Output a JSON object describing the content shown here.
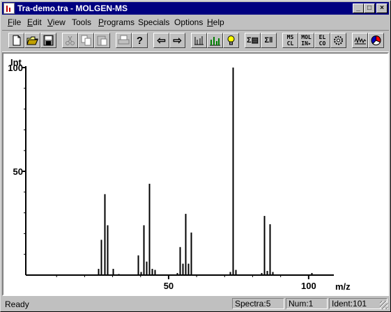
{
  "window": {
    "title": "Tra-demo.tra - MOLGEN-MS",
    "controls": {
      "minimize": "_",
      "maximize": "□",
      "close": "×"
    }
  },
  "menu": [
    {
      "label": "File",
      "key": "F",
      "rest": "ile"
    },
    {
      "label": "Edit",
      "key": "E",
      "rest": "dit"
    },
    {
      "label": "View",
      "key": "V",
      "rest": "iew"
    },
    {
      "label": "Tools",
      "key": "",
      "rest": "Tools"
    },
    {
      "label": "Programs",
      "key": "P",
      "rest": "rograms"
    },
    {
      "label": "Specials",
      "key": "",
      "rest": "Specials"
    },
    {
      "label": "Options",
      "key": "",
      "rest": "Options"
    },
    {
      "label": "Help",
      "key": "H",
      "rest": "elp"
    }
  ],
  "toolbar": {
    "new_icon": "new-document-icon",
    "open_icon": "open-folder-icon",
    "save_icon": "save-disk-icon",
    "cut_icon": "scissors-icon",
    "copy_icon": "copy-icon",
    "paste_icon": "paste-icon",
    "print_icon": "printer-icon",
    "help_glyph": "?",
    "back_glyph": "⇦",
    "forward_glyph": "⇨",
    "spectrum_list_glyph": "!! !!",
    "bar_chart_icon": "bar-chart-icon",
    "idea_icon": "light-bulb-icon",
    "sum_list_glyph": "Σ▤",
    "sum_glyph": "Σ‖",
    "ms_cl_glyph": "MS CL",
    "mol_in_glyph": "MOL IN▸",
    "el_co_glyph": "EL CO",
    "gear_icon": "gear-icon",
    "wave_icon": "wave-icon",
    "pie_icon": "pie-chart-icon"
  },
  "chart_data": {
    "type": "bar",
    "ylabel": "Int",
    "xlabel": "m/z",
    "xlim": [
      -1,
      109
    ],
    "ylim": [
      0,
      100
    ],
    "x_tick_labels": [
      50,
      100
    ],
    "x_minor_ticks": [
      10,
      20,
      30,
      40,
      60,
      70,
      80,
      90
    ],
    "y_tick_labels": [
      50,
      100
    ],
    "y_minor_ticks": [
      10,
      20,
      30,
      40,
      60,
      70,
      80,
      90
    ],
    "x": [
      25,
      26,
      27,
      28,
      30,
      32,
      39,
      40,
      41,
      42,
      43,
      44,
      45,
      53,
      54,
      55,
      56,
      57,
      58,
      72,
      73,
      74,
      83,
      84,
      85,
      86,
      87,
      101
    ],
    "values": [
      3,
      17,
      39,
      24,
      3,
      0.5,
      9.5,
      1.5,
      24,
      6.5,
      44,
      3,
      2.5,
      1,
      13.5,
      5.5,
      29.5,
      5.5,
      20.5,
      1.5,
      100,
      2.5,
      1,
      28.5,
      2,
      24.5,
      1.5,
      1
    ]
  },
  "status": {
    "ready": "Ready",
    "spectra": "Spectra:5",
    "num": "Num:1",
    "ident": "Ident:101"
  }
}
